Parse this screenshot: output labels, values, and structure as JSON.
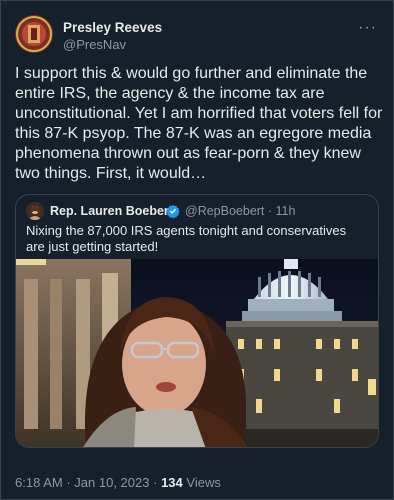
{
  "tweet": {
    "author_name": "Presley Reeves",
    "author_handle": "@PresNav",
    "more_icon": "more-horizontal-icon",
    "text": "I support this & would go further and eliminate the entire IRS, the agency & the income tax are unconstitutional. Yet I am horrified that voters fell for this 87-K psyop. The 87-K was an egregore media phenomena thrown out as fear-porn & they knew two things. First, it would…",
    "time": "6:18 AM",
    "separator": "·",
    "date": "Jan 10, 2023",
    "separator2": "·",
    "views_count": "134",
    "views_label": "Views"
  },
  "quoted": {
    "author_name": "Rep. Lauren Boebert",
    "verified_icon": "verified-badge-icon",
    "author_handle": "@RepBoebert · 11h",
    "text": "Nixing the 87,000 IRS agents tonight and conservatives are just getting started!"
  },
  "colors": {
    "background": "#15202b",
    "text": "#e7e9ea",
    "secondary": "#8b98a5",
    "border": "#38444d",
    "verified": "#1d9bf0"
  }
}
